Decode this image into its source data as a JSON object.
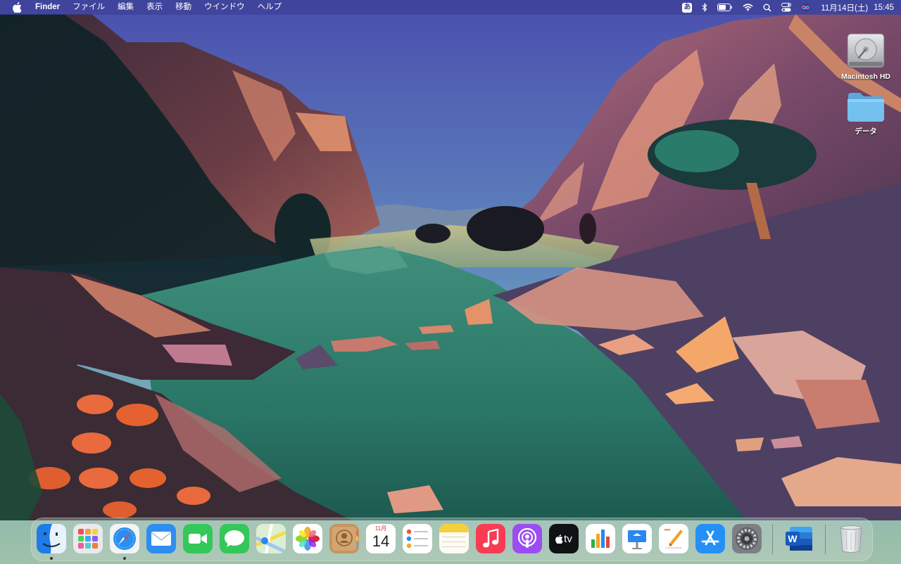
{
  "menubar": {
    "app_name": "Finder",
    "menus": [
      "ファイル",
      "編集",
      "表示",
      "移動",
      "ウインドウ",
      "ヘルプ"
    ],
    "status": {
      "input_method": "あ",
      "date": "11月14日(土)",
      "time": "15:45"
    }
  },
  "desktop_icons": [
    {
      "label": "Macintosh HD",
      "icon": "hard-drive-icon"
    },
    {
      "label": "データ",
      "icon": "folder-icon"
    }
  ],
  "dock": {
    "apps": [
      {
        "name": "Finder",
        "icon": "finder-icon",
        "running": true
      },
      {
        "name": "Launchpad",
        "icon": "launchpad-icon",
        "running": false
      },
      {
        "name": "Safari",
        "icon": "safari-icon",
        "running": true
      },
      {
        "name": "Mail",
        "icon": "mail-icon",
        "running": false
      },
      {
        "name": "FaceTime",
        "icon": "facetime-icon",
        "running": false
      },
      {
        "name": "Messages",
        "icon": "messages-icon",
        "running": false
      },
      {
        "name": "Maps",
        "icon": "maps-icon",
        "running": false
      },
      {
        "name": "Photos",
        "icon": "photos-icon",
        "running": false
      },
      {
        "name": "Contacts",
        "icon": "contacts-icon",
        "running": false
      },
      {
        "name": "Calendar",
        "icon": "calendar-icon",
        "running": false
      },
      {
        "name": "Reminders",
        "icon": "reminders-icon",
        "running": false
      },
      {
        "name": "Notes",
        "icon": "notes-icon",
        "running": false
      },
      {
        "name": "Music",
        "icon": "music-icon",
        "running": false
      },
      {
        "name": "Podcasts",
        "icon": "podcasts-icon",
        "running": false
      },
      {
        "name": "TV",
        "icon": "tv-icon",
        "running": false
      },
      {
        "name": "Numbers",
        "icon": "numbers-icon",
        "running": false
      },
      {
        "name": "Keynote",
        "icon": "keynote-icon",
        "running": false
      },
      {
        "name": "Pages",
        "icon": "pages-icon",
        "running": false
      },
      {
        "name": "App Store",
        "icon": "app-store-icon",
        "running": false
      },
      {
        "name": "System Preferences",
        "icon": "system-preferences-icon",
        "running": false
      },
      {
        "name": "Microsoft Word",
        "icon": "word-icon",
        "running": false
      },
      {
        "name": "Trash",
        "icon": "trash-icon",
        "running": false
      }
    ],
    "calendar_month": "11月",
    "calendar_day": "14",
    "tv_label": "tv",
    "word_letter": "W"
  },
  "colors": {
    "menubar": "#3c4096",
    "sky_top": "#4a55b0",
    "sky_bottom": "#6fa7b8",
    "water": "#2f7a6a",
    "rock_peach": "#e59a7a"
  }
}
